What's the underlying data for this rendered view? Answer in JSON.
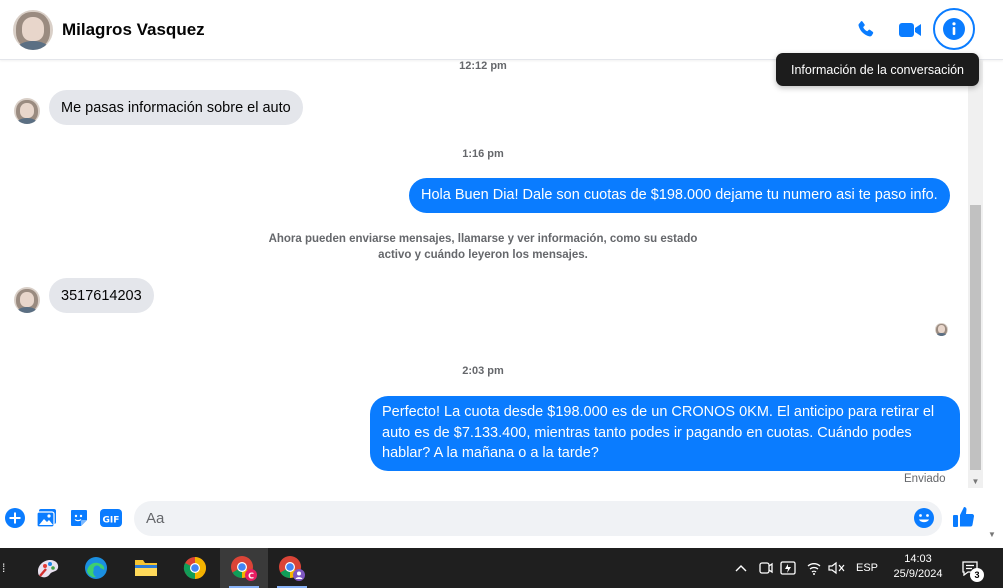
{
  "header": {
    "contact_name": "Milagros Vasquez",
    "tooltip": "Información de la conversación"
  },
  "messages": [
    {
      "type": "timestamp",
      "text": "12:12 pm"
    },
    {
      "type": "incoming",
      "text": "Me pasas información sobre el auto"
    },
    {
      "type": "timestamp",
      "text": "1:16 pm"
    },
    {
      "type": "outgoing",
      "text": "Hola Buen Dia! Dale son cuotas de $198.000 dejame tu numero asi te paso info."
    },
    {
      "type": "notice",
      "lines": [
        "Ahora pueden enviarse mensajes, llamarse y ver información, como su estado",
        "activo y cuándo leyeron los mensajes."
      ]
    },
    {
      "type": "incoming",
      "text": "3517614203"
    },
    {
      "type": "timestamp",
      "text": "2:03 pm"
    },
    {
      "type": "outgoing",
      "lines": [
        "Perfecto! La cuota desde $198.000 es de un CRONOS 0KM. El anticipo para retirar el",
        "auto es de $7.133.400, mientras tanto podes ir pagando en cuotas. Cuándo podes",
        "hablar? A la mañana o a la tarde?"
      ]
    }
  ],
  "status": {
    "sent": "Enviado"
  },
  "composer": {
    "placeholder": "Aa"
  },
  "taskbar": {
    "language": "ESP",
    "time": "14:03",
    "date": "25/9/2024",
    "notifications": "3"
  },
  "colors": {
    "accent": "#0a7cff",
    "incoming_bubble": "#e4e6eb",
    "taskbar": "#1f1f1f"
  }
}
